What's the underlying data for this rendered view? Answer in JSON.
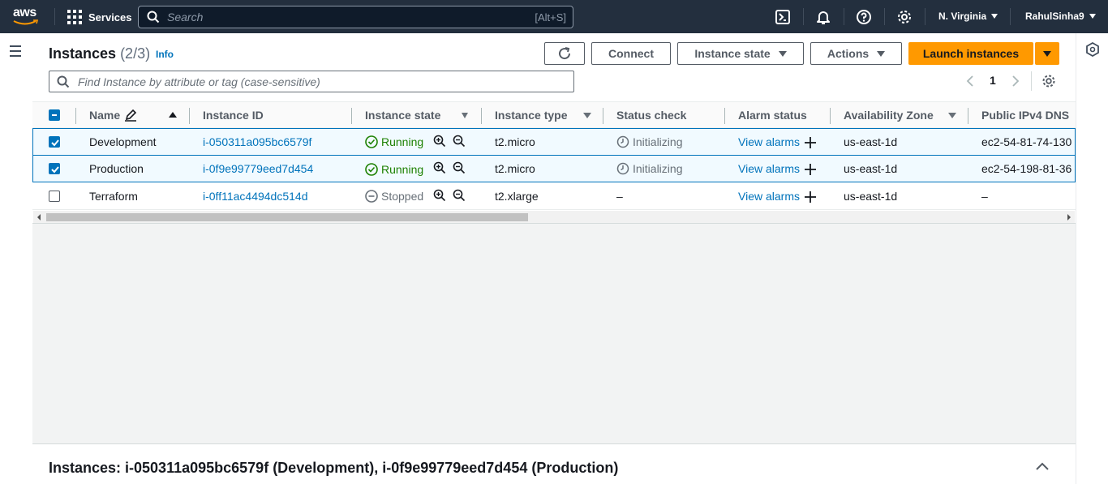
{
  "topnav": {
    "logo": "aws",
    "services_label": "Services",
    "search_placeholder": "Search",
    "search_shortcut": "[Alt+S]",
    "region": "N. Virginia",
    "user": "RahulSinha9"
  },
  "header": {
    "title": "Instances",
    "count": "(2/3)",
    "info": "Info",
    "connect": "Connect",
    "instance_state": "Instance state",
    "actions": "Actions",
    "launch": "Launch instances",
    "filter_placeholder": "Find Instance by attribute or tag (case-sensitive)",
    "page": "1"
  },
  "columns": {
    "name": "Name",
    "instance_id": "Instance ID",
    "instance_state": "Instance state",
    "instance_type": "Instance type",
    "status_check": "Status check",
    "alarm_status": "Alarm status",
    "availability_zone": "Availability Zone",
    "public_dns": "Public IPv4 DNS"
  },
  "rows": [
    {
      "selected": true,
      "name": "Development",
      "id": "i-050311a095bc6579f",
      "state": "Running",
      "type": "t2.micro",
      "status": "Initializing",
      "alarm": "View alarms",
      "az": "us-east-1d",
      "dns": "ec2-54-81-74-130"
    },
    {
      "selected": true,
      "name": "Production",
      "id": "i-0f9e99779eed7d454",
      "state": "Running",
      "type": "t2.micro",
      "status": "Initializing",
      "alarm": "View alarms",
      "az": "us-east-1d",
      "dns": "ec2-54-198-81-36"
    },
    {
      "selected": false,
      "name": "Terraform",
      "id": "i-0ff11ac4494dc514d",
      "state": "Stopped",
      "type": "t2.xlarge",
      "status": "–",
      "alarm": "View alarms",
      "az": "us-east-1d",
      "dns": "–"
    }
  ],
  "details": {
    "title": "Instances: i-050311a095bc6579f (Development), i-0f9e99779eed7d454 (Production)"
  },
  "colors": {
    "nav_bg": "#232f3e",
    "accent": "#ff9900",
    "link": "#0073bb",
    "running": "#1d8102"
  }
}
